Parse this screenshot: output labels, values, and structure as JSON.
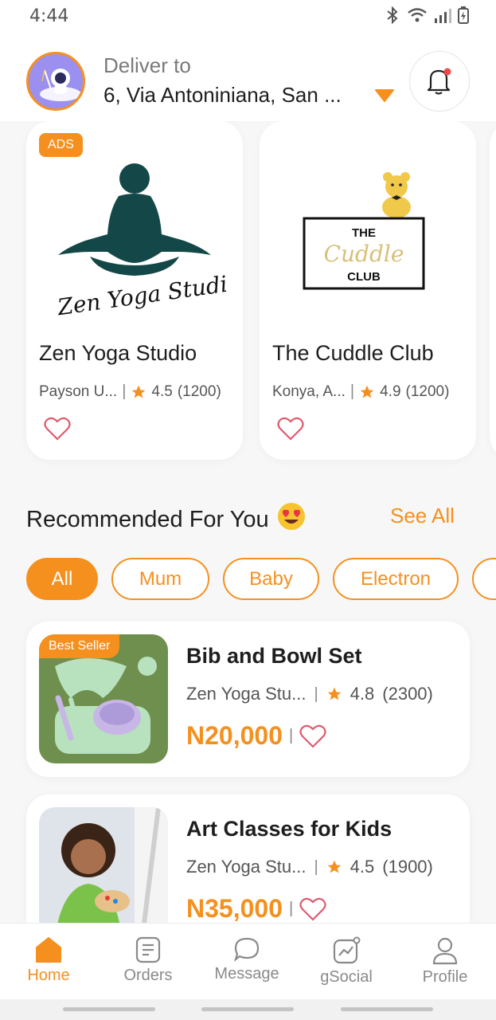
{
  "status": {
    "time": "4:44"
  },
  "header": {
    "deliver_label": "Deliver to",
    "address": "6, Via Antoniniana, San ..."
  },
  "ads": [
    {
      "badge": "ADS",
      "name": "Zen Yoga Studio",
      "location": "Payson U...",
      "rating": "4.5",
      "reviews": "(1200)",
      "logo_text": "Zen Yoga Studio"
    },
    {
      "badge": "",
      "name": "The Cuddle Club",
      "location": "Konya, A...",
      "rating": "4.9",
      "reviews": "(1200)",
      "logo_line1": "THE",
      "logo_line2": "Cuddle",
      "logo_line3": "CLUB"
    }
  ],
  "recommended": {
    "title": "Recommended For You",
    "emoji": "😍",
    "see_all": "See All",
    "chips": [
      "All",
      "Mum",
      "Baby",
      "Electron"
    ]
  },
  "products": [
    {
      "badge": "Best Seller",
      "title": "Bib and Bowl Set",
      "store": "Zen Yoga Stu...",
      "rating": "4.8",
      "reviews": "(2300)",
      "price": "N20,000"
    },
    {
      "badge": "",
      "title": "Art Classes for Kids",
      "store": "Zen Yoga Stu...",
      "rating": "4.5",
      "reviews": "(1900)",
      "price": "N35,000"
    }
  ],
  "nav": [
    {
      "label": "Home",
      "icon": "home-icon",
      "active": true
    },
    {
      "label": "Orders",
      "icon": "orders-icon",
      "active": false
    },
    {
      "label": "Message",
      "icon": "message-icon",
      "active": false
    },
    {
      "label": "gSocial",
      "icon": "gsocial-icon",
      "active": false
    },
    {
      "label": "Profile",
      "icon": "profile-icon",
      "active": false
    }
  ],
  "colors": {
    "accent": "#f5901f",
    "heart": "#e05a6e",
    "star": "#f5901f"
  }
}
